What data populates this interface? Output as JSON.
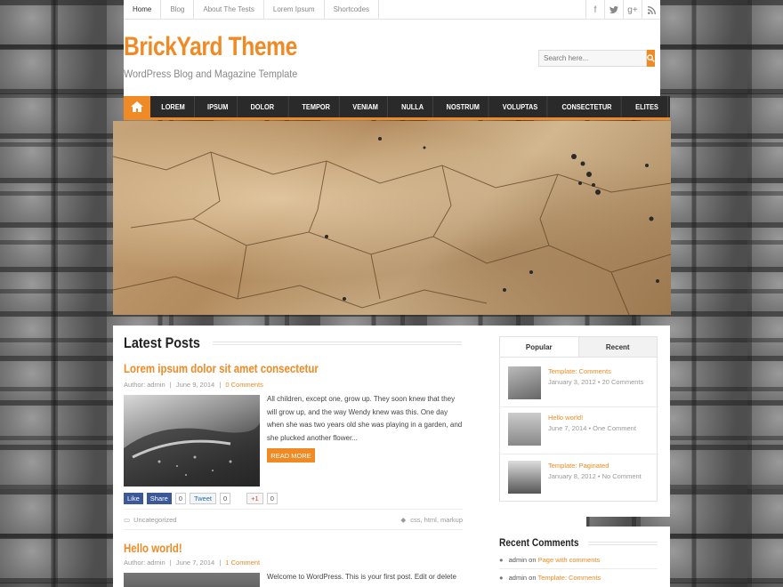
{
  "topnav": {
    "items": [
      "Home",
      "Blog",
      "About The Tests",
      "Lorem Ipsum",
      "Shortcodes"
    ],
    "social_icons": [
      "facebook-icon",
      "twitter-icon",
      "googleplus-icon",
      "rss-icon"
    ]
  },
  "header": {
    "title": "BrickYard Theme",
    "tagline": "WordPress Blog and Magazine Template",
    "search_placeholder": "Search here..."
  },
  "mainnav": {
    "items": [
      "LOREM",
      "IPSUM",
      "DOLOR SIT",
      "TEMPOR",
      "VENIAM",
      "NULLA",
      "NOSTRUM",
      "VOLUPTAS",
      "CONSECTETUR",
      "ELITES"
    ]
  },
  "content": {
    "section_title": "Latest Posts",
    "post1": {
      "title": "Lorem ipsum dolor sit amet consectetur",
      "author": "Author: admin",
      "date": "June 9, 2014",
      "comments": "0 Comments",
      "excerpt": "All children, except one, grow up. They soon knew that they will grow up, and the way Wendy knew was this. One day when she was two years old she was playing in a garden, and she plucked another flower...",
      "read_more": "READ MORE",
      "share": {
        "like": "Like",
        "share": "Share",
        "like_count": "0",
        "tweet": "Tweet",
        "tweet_count": "0",
        "gplus": "+1",
        "gplus_count": "0"
      },
      "category": "Uncategorized",
      "tags": "css, html, markup"
    },
    "post2": {
      "title": "Hello world!",
      "author": "Author: admin",
      "date": "June 7, 2014",
      "comments": "1 Comment",
      "excerpt": "Welcome to WordPress. This is your first post. Edit or delete"
    }
  },
  "sidebar": {
    "tabs": [
      "Popular",
      "Recent"
    ],
    "popular": [
      {
        "title": "Template: Comments",
        "meta": "January 3, 2012 • 20 Comments"
      },
      {
        "title": "Hello world!",
        "meta": "June 7, 2014 • One Comment"
      },
      {
        "title": "Template: Paginated",
        "meta": "January 8, 2012 • No Comment"
      }
    ],
    "recent_comments_title": "Recent Comments",
    "recent_comments": [
      {
        "author": "admin",
        "on": "on",
        "post": "Page with comments"
      },
      {
        "author": "admin",
        "on": "on",
        "post": "Template: Comments"
      }
    ]
  },
  "colors": {
    "accent": "#f08a24",
    "nav_bg": "#2a2a2a"
  }
}
